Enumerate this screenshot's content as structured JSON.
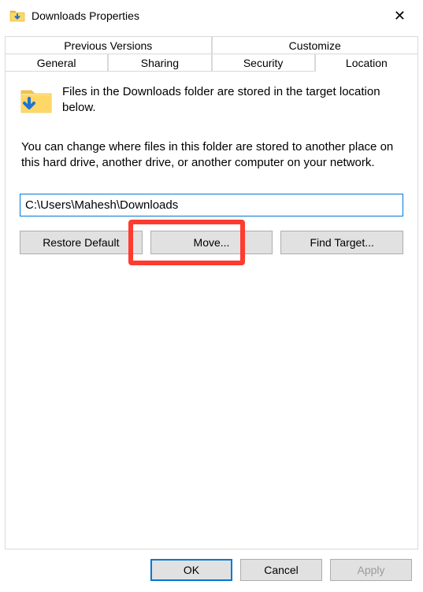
{
  "titlebar": {
    "title": "Downloads Properties"
  },
  "tabs": {
    "row1": [
      {
        "label": "Previous Versions"
      },
      {
        "label": "Customize"
      }
    ],
    "row2": [
      {
        "label": "General"
      },
      {
        "label": "Sharing"
      },
      {
        "label": "Security"
      },
      {
        "label": "Location"
      }
    ],
    "active": "Location"
  },
  "panel": {
    "intro": "Files in the Downloads folder are stored in the target location below.",
    "desc": "You can change where files in this folder are stored to another place on this hard drive, another drive, or another computer on your network.",
    "path": "C:\\Users\\Mahesh\\Downloads",
    "buttons": {
      "restore": "Restore Default",
      "move": "Move...",
      "find": "Find Target..."
    }
  },
  "dialog_buttons": {
    "ok": "OK",
    "cancel": "Cancel",
    "apply": "Apply"
  }
}
